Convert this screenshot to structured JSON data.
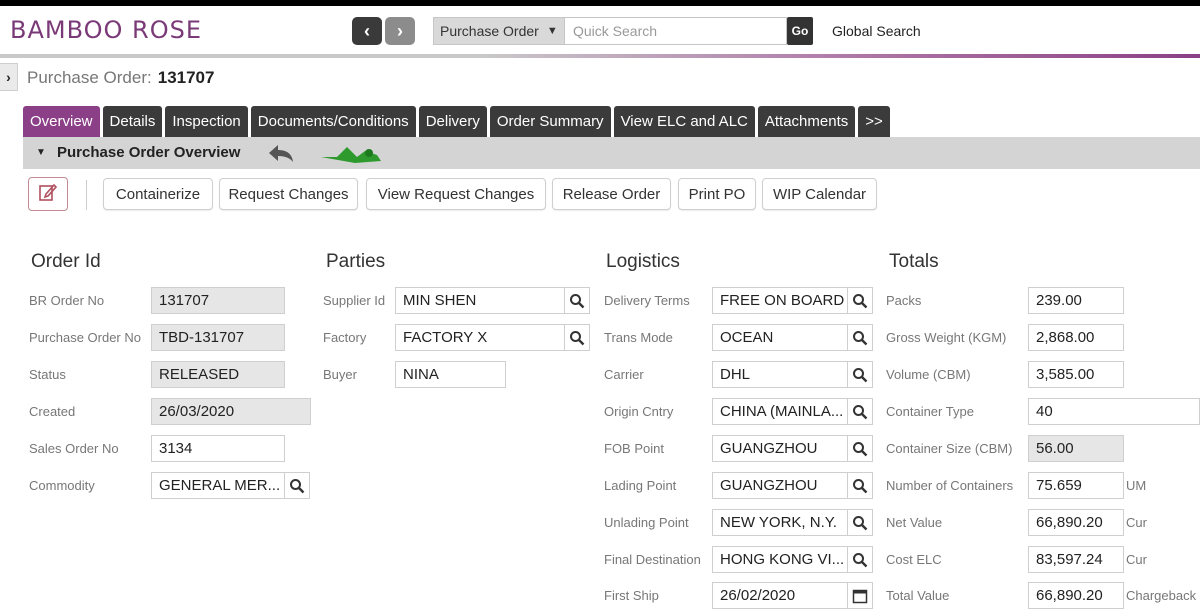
{
  "app": {
    "logo": "BAMBOO ROSE"
  },
  "colors": {
    "brand": "#8a3f86",
    "tab_bg": "#3b3b3b",
    "header_strip": "#000000"
  },
  "header": {
    "prev_icon": "chevron-left-icon",
    "next_icon": "chevron-right-icon",
    "search_type": "Purchase Order",
    "search_placeholder": "Quick Search",
    "go_label": "Go",
    "global_search_label": "Global Search"
  },
  "page": {
    "title_label": "Purchase Order:",
    "po_number": "131707"
  },
  "tabs": [
    {
      "label": "Overview",
      "active": true
    },
    {
      "label": "Details"
    },
    {
      "label": "Inspection"
    },
    {
      "label": "Documents/Conditions"
    },
    {
      "label": "Delivery"
    },
    {
      "label": "Order Summary"
    },
    {
      "label": "View ELC and ALC"
    },
    {
      "label": "Attachments"
    },
    {
      "label": ">>"
    }
  ],
  "subheader": {
    "title": "Purchase Order Overview"
  },
  "actions": [
    "Containerize",
    "Request Changes",
    "View Request Changes",
    "Release Order",
    "Print PO",
    "WIP Calendar"
  ],
  "order_id": {
    "title": "Order Id",
    "fields": [
      {
        "label": "BR Order No",
        "value": "131707"
      },
      {
        "label": "Purchase Order No",
        "value": "TBD-131707"
      },
      {
        "label": "Status",
        "value": "RELEASED"
      },
      {
        "label": "Created",
        "value": "26/03/2020"
      },
      {
        "label": "Sales Order No",
        "value": "3134"
      },
      {
        "label": "Commodity",
        "value": "GENERAL MER..."
      }
    ]
  },
  "parties": {
    "title": "Parties",
    "fields": [
      {
        "label": "Supplier Id",
        "value": "MIN SHEN"
      },
      {
        "label": "Factory",
        "value": "FACTORY X"
      },
      {
        "label": "Buyer",
        "value": "NINA"
      }
    ]
  },
  "logistics": {
    "title": "Logistics",
    "fields": [
      {
        "label": "Delivery Terms",
        "value": "FREE ON BOARD"
      },
      {
        "label": "Trans Mode",
        "value": "OCEAN"
      },
      {
        "label": "Carrier",
        "value": "DHL"
      },
      {
        "label": "Origin Cntry",
        "value": "CHINA (MAINLA..."
      },
      {
        "label": "FOB Point",
        "value": "GUANGZHOU"
      },
      {
        "label": "Lading Point",
        "value": "GUANGZHOU"
      },
      {
        "label": "Unlading Point",
        "value": "NEW YORK, N.Y."
      },
      {
        "label": "Final Destination",
        "value": "HONG KONG VI..."
      },
      {
        "label": "First Ship",
        "value": "26/02/2020"
      }
    ]
  },
  "totals": {
    "title": "Totals",
    "fields": [
      {
        "label": "Packs",
        "value": "239.00"
      },
      {
        "label": "Gross Weight (KGM)",
        "value": "2,868.00"
      },
      {
        "label": "Volume (CBM)",
        "value": "3,585.00"
      },
      {
        "label": "Container Type",
        "value": "40"
      },
      {
        "label": "Container Size (CBM)",
        "value": "56.00"
      },
      {
        "label": "Number of Containers",
        "value": "75.659",
        "unit": "UM"
      },
      {
        "label": "Net Value",
        "value": "66,890.20",
        "unit": "Cur"
      },
      {
        "label": "Cost ELC",
        "value": "83,597.24",
        "unit": "Cur"
      },
      {
        "label": "Total Value",
        "value": "66,890.20",
        "unit": "Chargeback"
      }
    ]
  }
}
